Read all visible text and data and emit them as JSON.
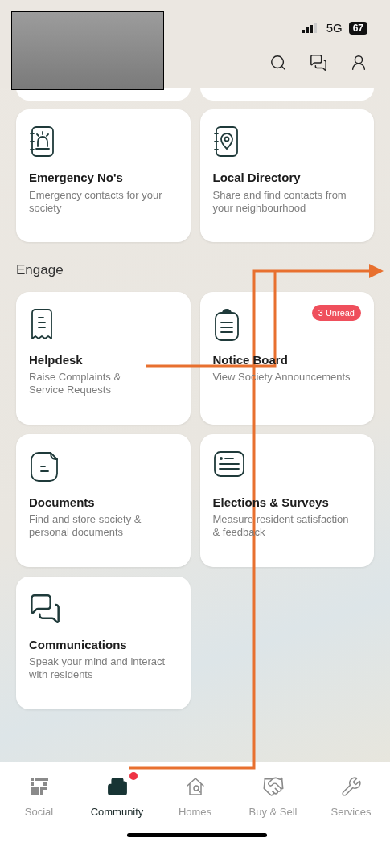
{
  "status_bar": {
    "network": "5G",
    "battery": "67"
  },
  "header": {
    "actions": [
      {
        "kind": "search"
      },
      {
        "kind": "chat"
      },
      {
        "kind": "profile"
      }
    ]
  },
  "top_cards": [
    {
      "title": "Emergency No's",
      "description": "Emergency contacts for your society"
    },
    {
      "title": "Local Directory",
      "description": "Share and find contacts from your neighbourhood"
    }
  ],
  "engage": {
    "title": "Engage",
    "unread_badge": "3 Unread",
    "cards": [
      {
        "title": "Helpdesk",
        "description": "Raise Complaints & Service Requests"
      },
      {
        "title": "Notice Board",
        "description": "View Society Announcements"
      },
      {
        "title": "Documents",
        "description": "Find and store society & personal documents"
      },
      {
        "title": "Elections & Surveys",
        "description": "Measure resident satisfaction & feedback"
      },
      {
        "title": "Communications",
        "description": "Speak your mind and interact with residents"
      }
    ]
  },
  "bottom_nav": [
    {
      "label": "Social",
      "selected": false,
      "dot": false
    },
    {
      "label": "Community",
      "selected": true,
      "dot": true
    },
    {
      "label": "Homes",
      "selected": false,
      "dot": false
    },
    {
      "label": "Buy & Sell",
      "selected": false,
      "dot": false
    },
    {
      "label": "Services",
      "selected": false,
      "dot": false
    }
  ]
}
